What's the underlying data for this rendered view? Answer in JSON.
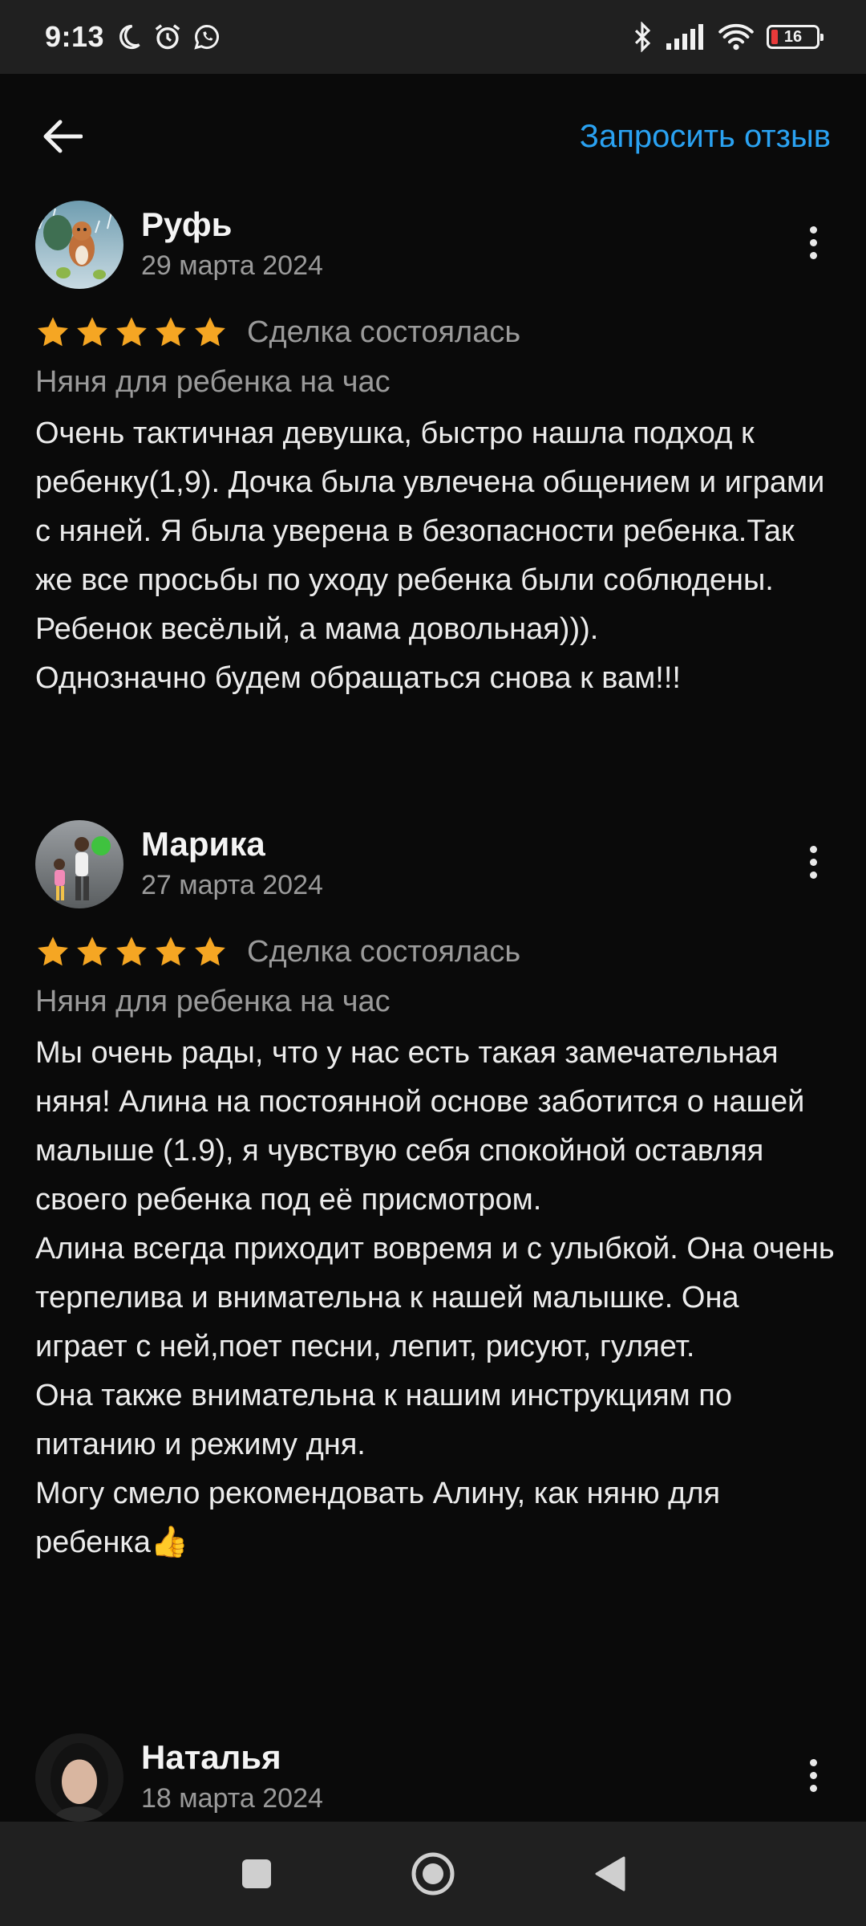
{
  "status_bar": {
    "time": "9:13",
    "battery": "16",
    "icons": [
      "moon-icon",
      "alarm-icon",
      "whatsapp-icon",
      "bluetooth-icon",
      "signal-icon",
      "wifi-icon",
      "battery-icon"
    ]
  },
  "header": {
    "request_review": "Запросить отзыв"
  },
  "colors": {
    "accent": "#2aa2f2",
    "star": "#f5a623",
    "background": "#0a0a0a",
    "battery_low": "#e83a3a"
  },
  "reviews": [
    {
      "author": "Руфь",
      "date": "29 марта 2024",
      "rating": 5,
      "deal_status": "Сделка состоялась",
      "service": "Няня для ребенка на час",
      "text": "Очень тактичная девушка, быстро нашла подход к ребенку(1,9). Дочка была увлечена общением и играми с няней.  Я была уверена в безопасности ребенка.Так же все просьбы по уходу ребенка были соблюдены.\nРебенок весёлый, а мама довольная))).\nОднозначно будем обращаться снова к вам!!!"
    },
    {
      "author": "Марика",
      "date": "27 марта 2024",
      "rating": 5,
      "deal_status": "Сделка состоялась",
      "service": "Няня для ребенка на час",
      "text": "Мы очень рады, что у нас есть такая замечательная няня! Алина  на постоянной основе заботится о нашей  малыше (1.9), я чувствую себя спокойной оставляя своего ребенка под её присмотром.\nАлина всегда приходит вовремя и с улыбкой. Она очень терпелива и внимательна к нашей малышке. Она играет с ней,поет песни, лепит, рисуют, гуляет.\nОна также внимательна к нашим инструкциям по питанию и режиму дня.\nМогу смело рекомендовать Алину, как няню  для ребенка👍"
    },
    {
      "author": "Наталья",
      "date": "18 марта 2024"
    }
  ],
  "nav": {
    "icons": [
      "recents-square-icon",
      "home-circle-icon",
      "back-triangle-icon"
    ]
  }
}
